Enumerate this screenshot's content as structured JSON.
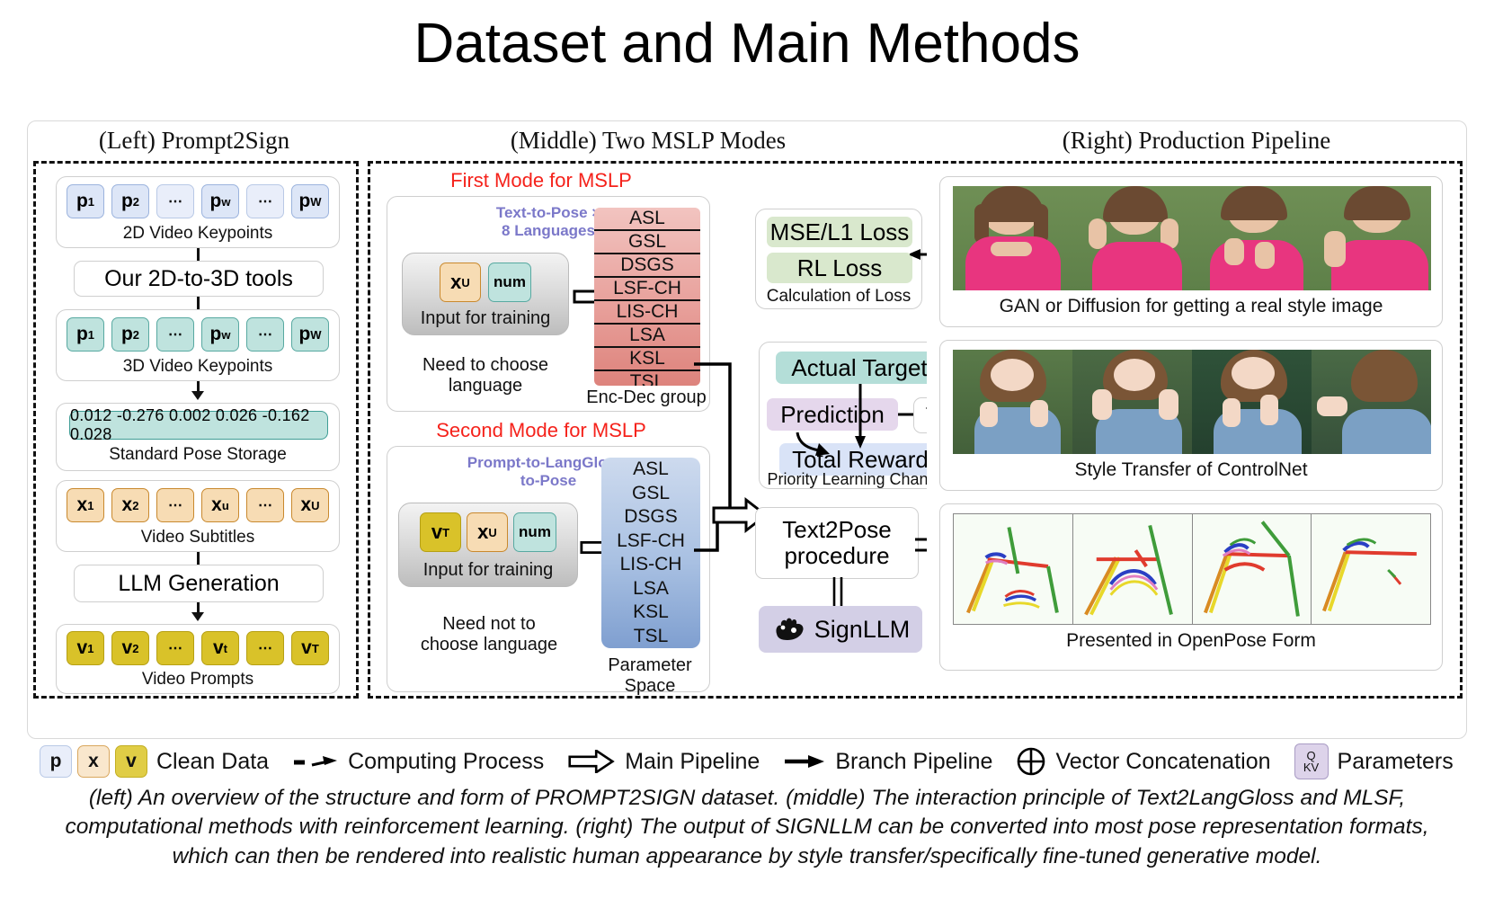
{
  "title": "Dataset and Main Methods",
  "columns": {
    "left": "(Left) Prompt2Sign",
    "middle": "(Middle) Two MSLP Modes",
    "right": "(Right) Production Pipeline"
  },
  "left_panel": {
    "keypoints_2d": {
      "label": "2D Video Keypoints",
      "tokens": [
        "p1",
        "p2",
        "…",
        "pw",
        "…",
        "pW"
      ],
      "tokens_detail": [
        {
          "base": "p",
          "sub": "1"
        },
        {
          "base": "p",
          "sub": "2"
        },
        {
          "base": "⋯",
          "sub": ""
        },
        {
          "base": "p",
          "sub": "w"
        },
        {
          "base": "⋯",
          "sub": ""
        },
        {
          "base": "p",
          "sub": "W"
        }
      ]
    },
    "tool_step_1": "Our 2D-to-3D tools",
    "keypoints_3d": {
      "label": "3D Video Keypoints",
      "tokens_detail": [
        {
          "base": "p",
          "sub": "1"
        },
        {
          "base": "p",
          "sub": "2"
        },
        {
          "base": "⋯",
          "sub": ""
        },
        {
          "base": "p",
          "sub": "w"
        },
        {
          "base": "⋯",
          "sub": ""
        },
        {
          "base": "p",
          "sub": "W"
        }
      ]
    },
    "pose_storage": {
      "label": "Standard Pose Storage",
      "values": "0.012 -0.276 0.002 0.026 -0.162 0.028"
    },
    "subtitles": {
      "label": "Video Subtitles",
      "tokens_detail": [
        {
          "base": "x",
          "sub": "1"
        },
        {
          "base": "x",
          "sub": "2"
        },
        {
          "base": "⋯",
          "sub": ""
        },
        {
          "base": "x",
          "sub": "u"
        },
        {
          "base": "⋯",
          "sub": ""
        },
        {
          "base": "x",
          "sub": "U"
        }
      ]
    },
    "tool_step_2": "LLM Generation",
    "prompts": {
      "label": "Video Prompts",
      "tokens_detail": [
        {
          "base": "v",
          "sub": "1"
        },
        {
          "base": "v",
          "sub": "2"
        },
        {
          "base": "⋯",
          "sub": ""
        },
        {
          "base": "v",
          "sub": "t"
        },
        {
          "base": "⋯",
          "sub": ""
        },
        {
          "base": "v",
          "sub": "T"
        }
      ]
    }
  },
  "middle_panel": {
    "first_mode": {
      "heading": "First Mode for MSLP",
      "subtitle_line1": "Text-to-Pose ×",
      "subtitle_line2": "8 Languages",
      "input_label": "Input for training",
      "input_chips": [
        {
          "base": "x",
          "sub": "U",
          "style": "tan"
        },
        {
          "base": "num",
          "sub": "",
          "style": "num"
        }
      ],
      "note": "Need to choose\nlanguage",
      "stack_label": "Enc-Dec group",
      "languages": [
        "ASL",
        "GSL",
        "DSGS",
        "LSF-CH",
        "LIS-CH",
        "LSA",
        "KSL",
        "TSL"
      ]
    },
    "second_mode": {
      "heading": "Second Mode for MSLP",
      "subtitle_line1": "Prompt-to-LangGloss-",
      "subtitle_line2": "to-Pose",
      "input_label": "Input for training",
      "input_chips": [
        {
          "base": "v",
          "sub": "T",
          "style": "gold"
        },
        {
          "base": "x",
          "sub": "U",
          "style": "tan"
        },
        {
          "base": "num",
          "sub": "",
          "style": "num"
        }
      ],
      "note": "Need not to\nchoose language",
      "stack_label": "Parameter Space",
      "languages": [
        "ASL",
        "GSL",
        "DSGS",
        "LSF-CH",
        "LIS-CH",
        "LSA",
        "KSL",
        "TSL"
      ]
    },
    "loss_box": {
      "label": "Calculation of Loss",
      "items": [
        "MSE/L1 Loss",
        "RL Loss"
      ]
    },
    "plc_box": {
      "label": "Priority Learning Channel",
      "actual_target": "Actual Target",
      "prediction": "Prediction",
      "total_reward": "Total Reward",
      "train": "Train"
    },
    "text2pose": {
      "line1": "Text2Pose",
      "line2": "procedure"
    },
    "signllm": {
      "label": "SignLLM",
      "icon": "sign-hand-icon"
    }
  },
  "right_panel": {
    "gan_row": {
      "caption": "GAN or Diffusion for getting a real style image",
      "frames": 4
    },
    "controlnet_row": {
      "caption": "Style Transfer of ControlNet",
      "frames": 4
    },
    "openpose_row": {
      "caption": "Presented in OpenPose Form",
      "frames": 4
    }
  },
  "legend": {
    "chips": [
      {
        "base": "p",
        "style": "blue-l"
      },
      {
        "base": "x",
        "style": "tan-l"
      },
      {
        "base": "v",
        "style": "gold-l"
      }
    ],
    "items": [
      {
        "icon": "clean-data-chips-icon",
        "text": "Clean Data"
      },
      {
        "icon": "dashed-arrow-icon",
        "text": "Computing Process"
      },
      {
        "icon": "hollow-arrow-icon",
        "text": "Main Pipeline"
      },
      {
        "icon": "solid-arrow-icon",
        "text": "Branch Pipeline"
      },
      {
        "icon": "circle-plus-icon",
        "text": "Vector Concatenation"
      },
      {
        "icon": "qkv-icon",
        "text": "Parameters"
      }
    ],
    "qkv": {
      "q": "Q",
      "kv": "KV"
    }
  },
  "caption": "(left) An overview of the structure and form of PROMPT2SIGN dataset. (middle) The interaction principle of Text2LangGloss and MLSF, computational methods with reinforcement learning. (right) The output of SIGNLLM can be converted into most pose representation formats, which can then be rendered into realistic human appearance by style transfer/specifically fine-tuned generative model.",
  "colors": {
    "mode_heading": "#f5221b",
    "subtitle_purple": "#7b78c9",
    "enc_dec_red": "#e0918b",
    "param_space_blue": "#a8c0e2",
    "teal": "#bfe3de",
    "gold": "#d9c229",
    "tan": "#f7dcb4",
    "lilac": "#e5d7ec",
    "green": "#d9e8cd"
  }
}
